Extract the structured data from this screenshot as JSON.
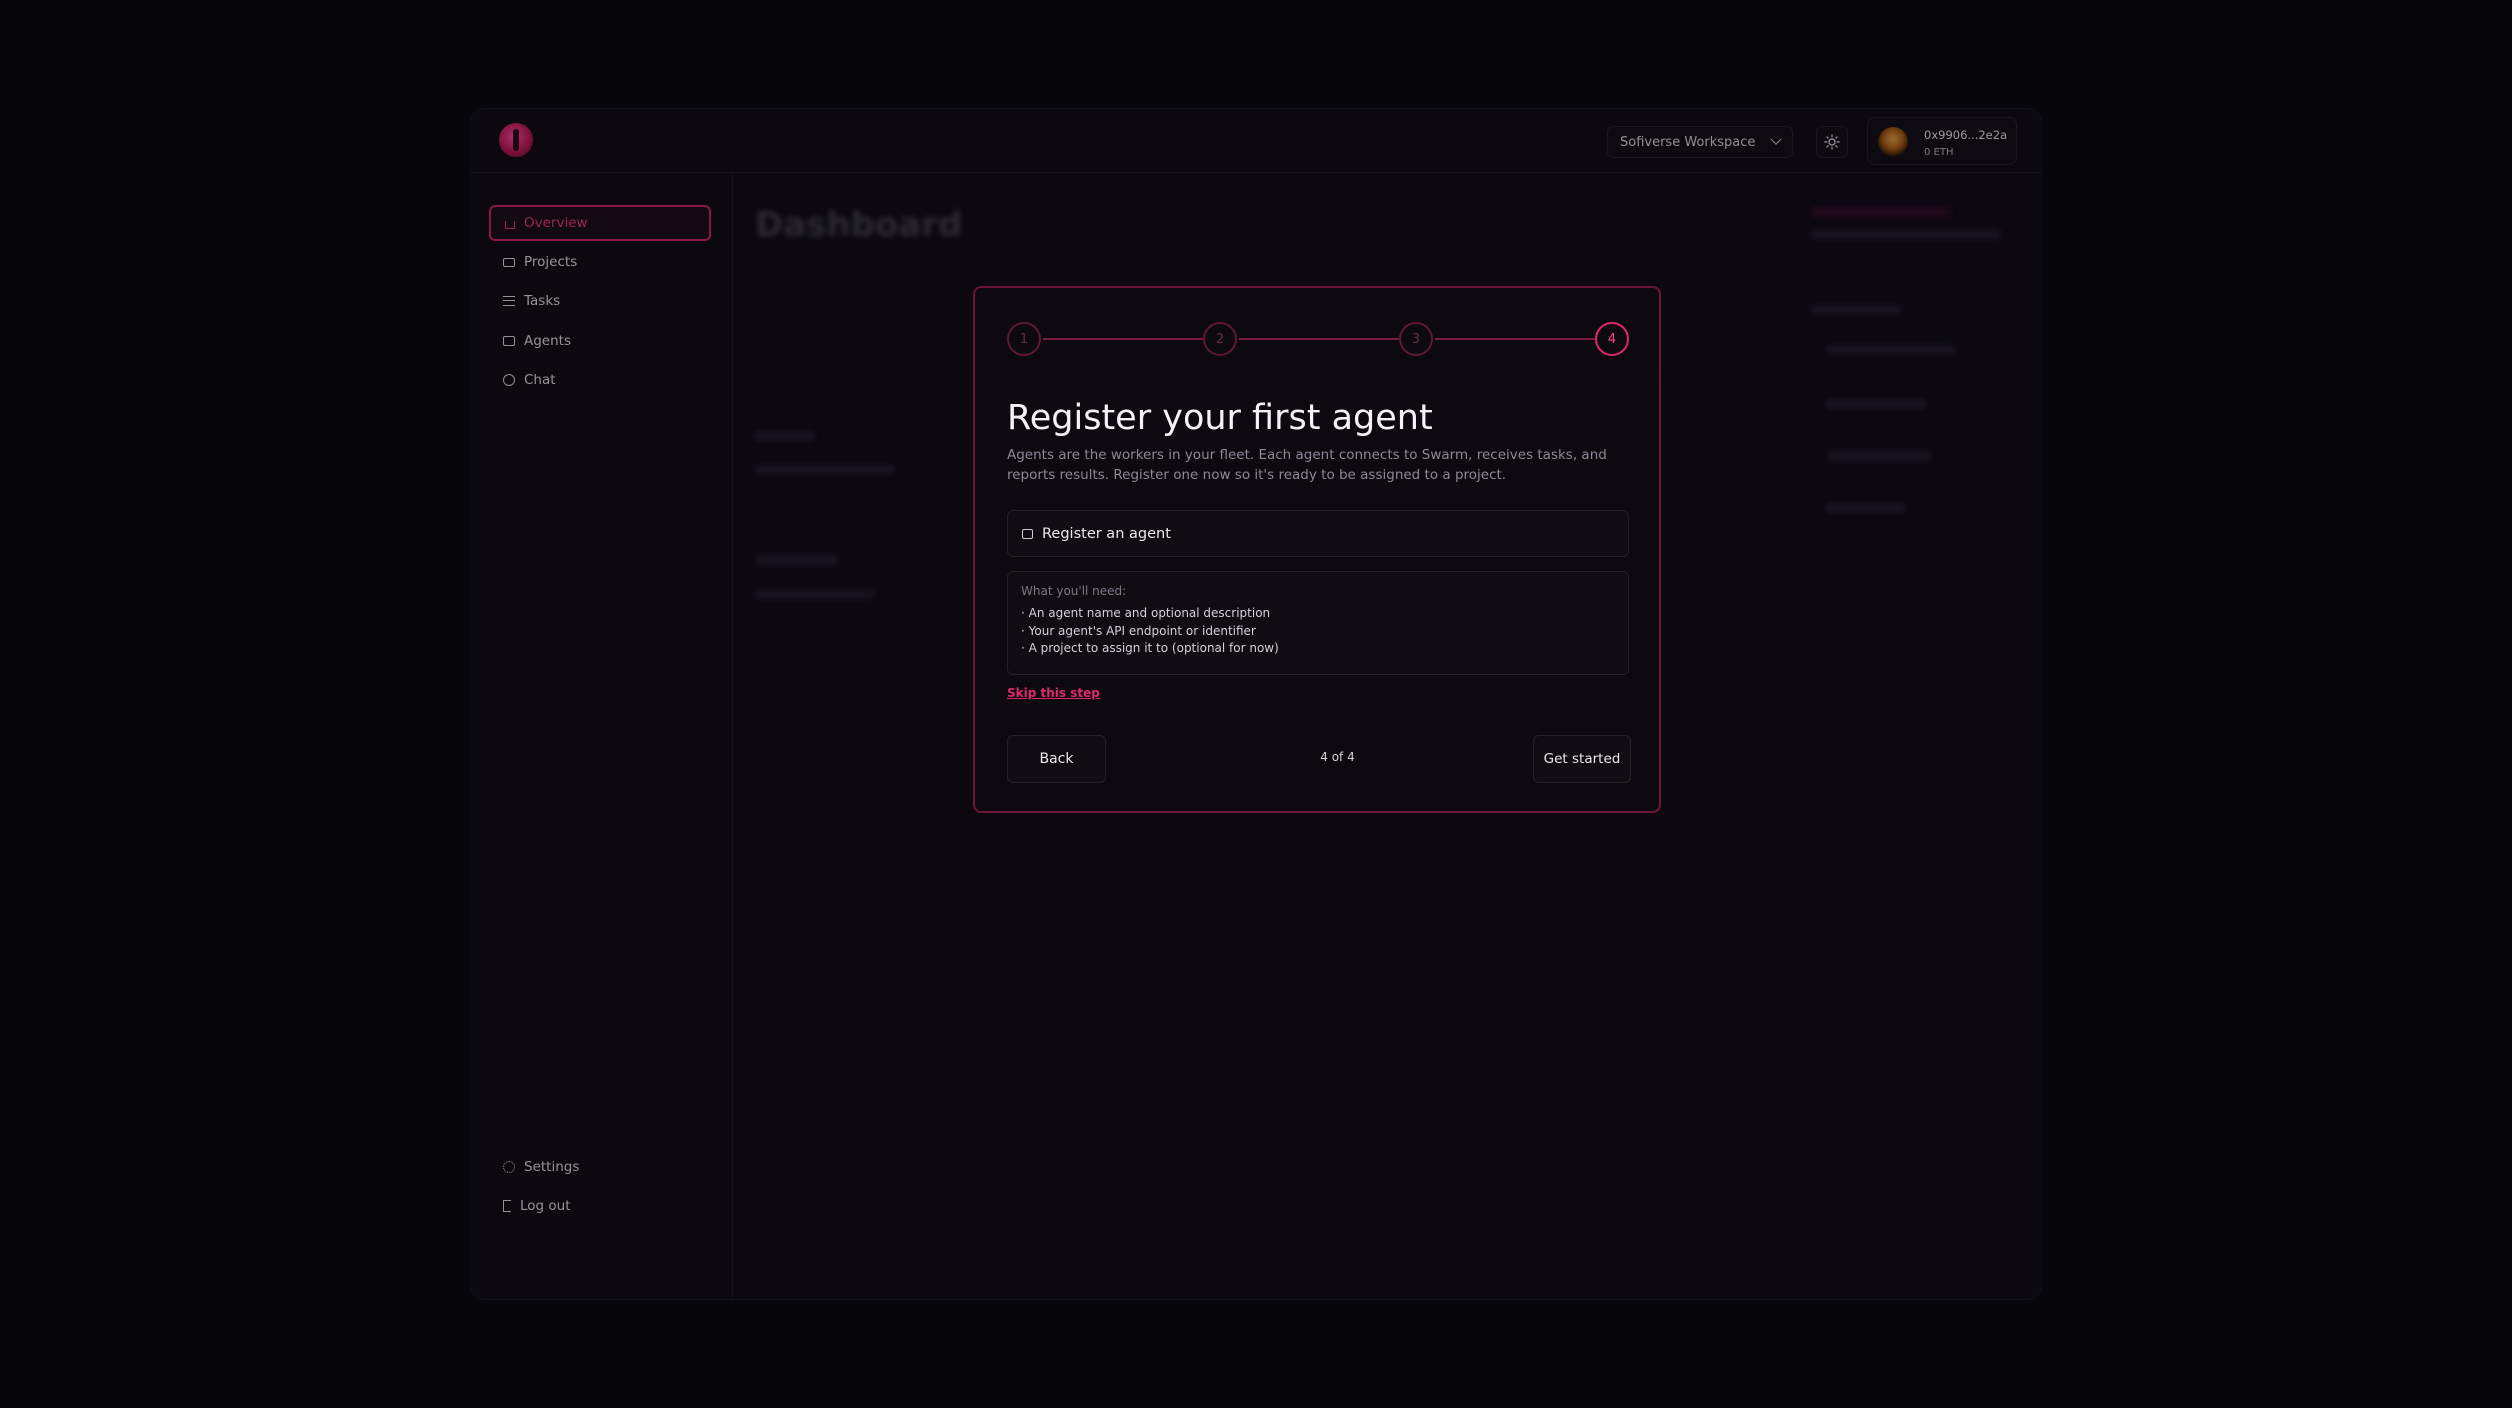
{
  "header": {
    "workspace": "Sofiverse Workspace",
    "wallet_address": "0x9906...2e2a",
    "wallet_balance": "0 ETH"
  },
  "sidebar": {
    "items": [
      {
        "label": "Overview",
        "icon": "home-icon",
        "active": true
      },
      {
        "label": "Projects",
        "icon": "folder-icon"
      },
      {
        "label": "Tasks",
        "icon": "list-icon"
      },
      {
        "label": "Agents",
        "icon": "bot-icon"
      },
      {
        "label": "Chat",
        "icon": "chat-icon"
      }
    ],
    "bottom": [
      {
        "label": "Settings",
        "icon": "gear-icon"
      },
      {
        "label": "Log out",
        "icon": "logout-icon"
      }
    ]
  },
  "background": {
    "title": "Dashboard"
  },
  "modal": {
    "steps": [
      "1",
      "2",
      "3",
      "4"
    ],
    "current_step": 4,
    "title": "Register your first agent",
    "description": "Agents are the workers in your fleet. Each agent connects to Swarm, receives tasks, and reports results. Register one now so it's ready to be assigned to a project.",
    "register_label": "Register an agent",
    "needs_heading": "What you'll need:",
    "needs": [
      "· An agent name and optional description",
      "· Your agent's API endpoint or identifier",
      "· A project to assign it to (optional for now)"
    ],
    "skip_label": "Skip this step",
    "back_label": "Back",
    "progress": "4 of 4",
    "primary_label": "Get started"
  },
  "colors": {
    "accent": "#e2246f",
    "background": "#09080c",
    "panel": "#0e0b14"
  }
}
